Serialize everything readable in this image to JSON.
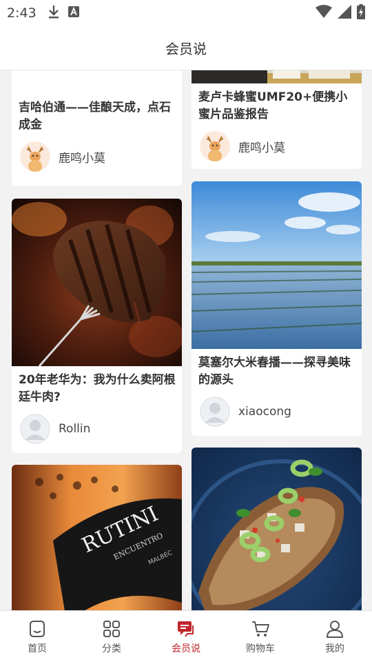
{
  "status_bar": {
    "time": "2:43",
    "icons": [
      "download-icon",
      "text-input-icon",
      "wifi-icon",
      "signal-icon",
      "battery-charging-icon"
    ]
  },
  "header": {
    "title": "会员说"
  },
  "feed": {
    "cards": [
      {
        "title": "吉哈伯通——佳酿天成，点石成金",
        "author": "鹿鸣小莫",
        "image": "wine-label-image",
        "avatar": "deer-avatar"
      },
      {
        "title": "麦卢卡蜂蜜UMF20+便携小蜜片品鉴报告",
        "author": "鹿鸣小莫",
        "image": "honey-package-image",
        "avatar": "deer-avatar"
      },
      {
        "title": "20年老华为：我为什么卖阿根廷牛肉?",
        "author": "Rollin",
        "image": "steak-on-fork-image",
        "avatar": "default-avatar"
      },
      {
        "title": "莫塞尔大米春播——探寻美味的源头",
        "author": "xiaocong",
        "image": "rice-paddy-image",
        "avatar": "default-avatar"
      },
      {
        "title": "",
        "author": "",
        "image": "wine-bottle-label-image",
        "label_text": "RUTINI",
        "label_subtext": "ENCUENTRO",
        "label_small": "MALBEC"
      },
      {
        "title": "",
        "author": "",
        "image": "bruschetta-plate-image"
      }
    ]
  },
  "bottom_nav": {
    "active": "会员说",
    "accent_color": "#c0272d",
    "items": [
      {
        "label": "首页",
        "icon": "home-icon"
      },
      {
        "label": "分类",
        "icon": "grid-icon"
      },
      {
        "label": "会员说",
        "icon": "chat-icon"
      },
      {
        "label": "购物车",
        "icon": "cart-icon"
      },
      {
        "label": "我的",
        "icon": "user-icon"
      }
    ]
  }
}
